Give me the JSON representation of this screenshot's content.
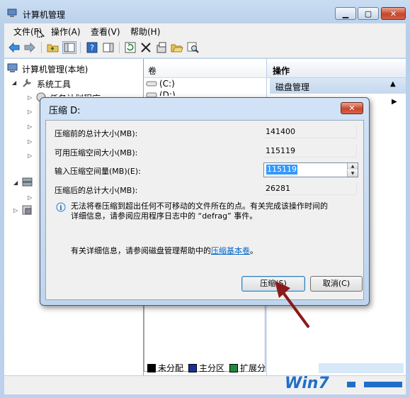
{
  "window": {
    "title": "计算机管理"
  },
  "menubar": {
    "items": [
      "文件(F)",
      "操作(A)",
      "查看(V)",
      "帮助(H)"
    ]
  },
  "tree": {
    "root": "计算机管理(本地)",
    "system_tools": "系统工具",
    "task_scheduler_partial": "任务计划程序"
  },
  "volume_list": {
    "column": "卷",
    "rows": [
      "(C:)",
      "(D:)"
    ]
  },
  "actions": {
    "title": "操作",
    "section": "磁盘管理"
  },
  "legend": {
    "items": [
      {
        "label": "未分配",
        "color": "#000000"
      },
      {
        "label": "主分区",
        "color": "#1a2f9c"
      },
      {
        "label": "扩展分",
        "color": "#1e8a3a"
      }
    ]
  },
  "dialog": {
    "title": "压缩 D:",
    "rows": [
      {
        "label": "压缩前的总计大小(MB):",
        "value": "141400"
      },
      {
        "label": "可用压缩空间大小(MB):",
        "value": "115119"
      },
      {
        "label": "输入压缩空间量(MB)(E):",
        "value": "115119"
      },
      {
        "label": "压缩后的总计大小(MB):",
        "value": "26281"
      }
    ],
    "info_line1": "无法将卷压缩到超出任何不可移动的文件所在的点。有关完成该操作时间的",
    "info_line2": "详细信息，请参阅应用程序日志中的 “defrag” 事件。",
    "help_prefix": "有关详细信息，请参阅磁盘管理帮助中的",
    "help_link": "压缩基本卷",
    "help_suffix": "。",
    "shrink_button": "压缩(S)",
    "cancel_button": "取消(C)"
  },
  "watermark": {
    "text": "Win7"
  },
  "colors": {
    "frame": "#bcd2ec",
    "arrow": "#8b1a1a",
    "link": "#0066cc"
  }
}
